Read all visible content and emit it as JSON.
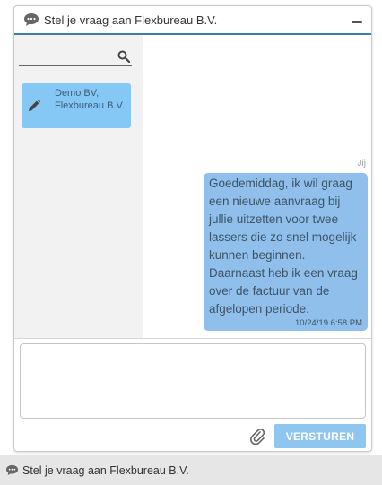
{
  "header": {
    "title": "Stel je vraag aan Flexbureau B.V.",
    "icon": "chat-icon",
    "minimize_icon": "minimize-icon"
  },
  "sidebar": {
    "search": {
      "value": "",
      "placeholder": "",
      "icon": "search-icon"
    },
    "conversations": [
      {
        "name": "Demo BV, Flexbureau B.V.",
        "icon": "pencil-icon"
      }
    ]
  },
  "messages": [
    {
      "sender": "Jij",
      "text": "Goedemiddag, ik wil graag\neen nieuwe aanvraag bij\njullie uitzetten voor twee\nlassers die zo snel mogelijk\nkunnen beginnen.\nDaarnaast heb ik een vraag\nover de factuur van de\nafgelopen periode.",
      "time": "10/24/19 6:58 PM"
    }
  ],
  "composer": {
    "value": "",
    "placeholder": "",
    "attach_icon": "paperclip-icon",
    "send_label": "VERSTUREN"
  },
  "bottom_bar": {
    "label": "Stel je vraag aan Flexbureau B.V.",
    "icon": "chat-icon"
  },
  "colors": {
    "accent": "#3e7ea6",
    "conversation_highlight": "#86c8f5",
    "bubble": "#8fbfea",
    "send_button": "#8ec6ef"
  }
}
